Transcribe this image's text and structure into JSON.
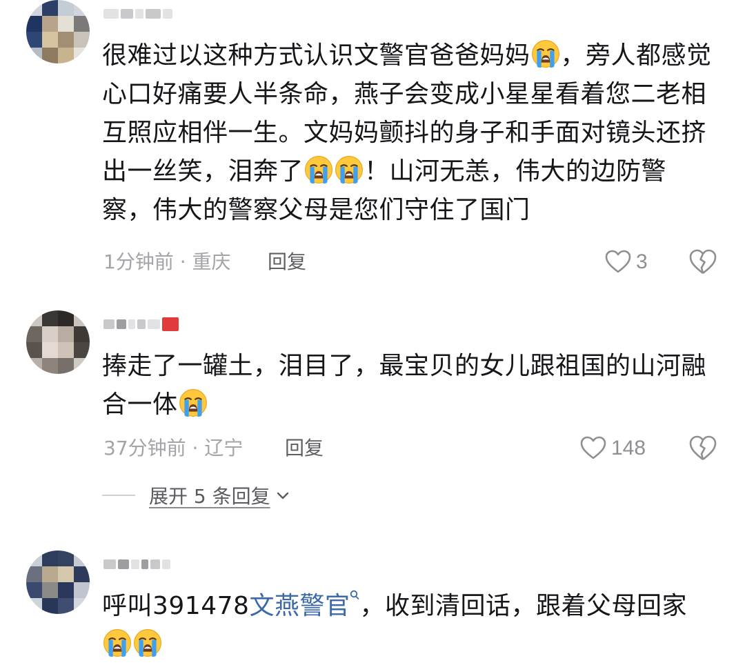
{
  "comments": [
    {
      "text_before": "很难过以这种方式认识文警官爸爸妈妈",
      "text_after": "，旁人都感觉心口好痛要人半条命，燕子会变成小星星看着您二老相互照应相伴一生。文妈妈颤抖的身子和手面对镜头还挤出一丝笑，泪奔了",
      "text_tail": "！山河无恙，伟大的边防警察，伟大的警察父母是您们守住了国门",
      "time": "1分钟前 · 重庆",
      "reply_label": "回复",
      "likes": "3"
    },
    {
      "text_before": "捧走了一罐土，泪目了，最宝贝的女儿跟祖国的山河融合一体",
      "time": "37分钟前 · 辽宁",
      "reply_label": "回复",
      "likes": "148",
      "expand_label": "展开 5 条回复"
    },
    {
      "text_before": "呼叫391478",
      "mention": "文燕警官",
      "text_after": "，收到清回话，跟着父母回家"
    }
  ],
  "icons": {
    "emoji": "loudly-crying-face",
    "like": "heart-outline",
    "dislike": "broken-heart-outline",
    "expand": "chevron-down",
    "mention": "search"
  },
  "colors": {
    "text": "#16161a",
    "meta": "#a3a3a8",
    "mention": "#3a6aa8",
    "emoji_face": "#ffc83d",
    "emoji_tears": "#3fa0f0"
  }
}
